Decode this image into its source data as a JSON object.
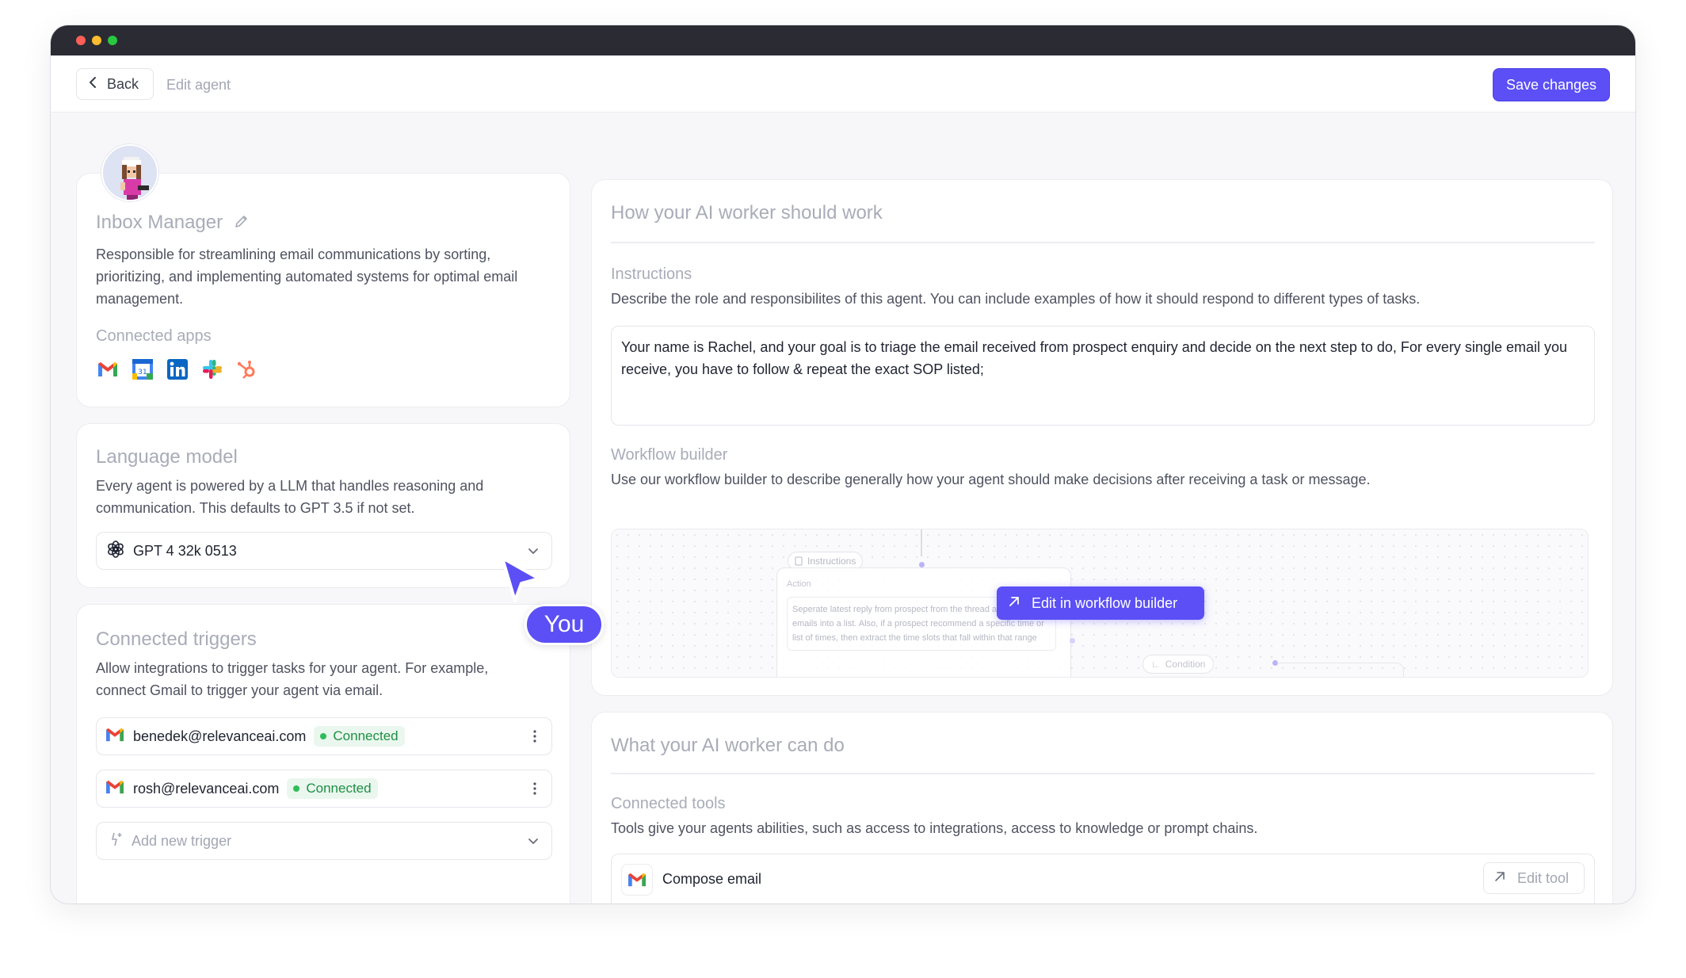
{
  "topbar": {
    "back_label": "Back",
    "breadcrumb": "Edit agent",
    "save_label": "Save changes"
  },
  "agent": {
    "name": "Inbox Manager",
    "description": "Responsible for streamlining email communications by sorting, prioritizing, and implementing automated systems for optimal email management.",
    "connected_apps_label": "Connected apps",
    "apps": [
      "gmail-icon",
      "google-calendar-icon",
      "linkedin-icon",
      "slack-icon",
      "hubspot-icon"
    ]
  },
  "language_model": {
    "title": "Language model",
    "description": "Every agent is powered by a LLM that handles reasoning and communication. This defaults to GPT 3.5 if not set.",
    "selected": "GPT 4 32k 0513"
  },
  "triggers": {
    "title": "Connected triggers",
    "description": "Allow integrations to trigger tasks for your agent. For example, connect Gmail to trigger your agent via email.",
    "items": [
      {
        "email": "benedek@relevanceai.com",
        "status": "Connected"
      },
      {
        "email": "rosh@relevanceai.com",
        "status": "Connected"
      }
    ],
    "add_placeholder": "Add new trigger"
  },
  "how_work": {
    "title": "How your AI worker should work",
    "instructions_label": "Instructions",
    "instructions_desc": "Describe the role and responsibilites of this agent. You can include examples of how it should respond to different types of tasks.",
    "instructions_value": "Your name is Rachel, and your goal is to triage the email received from prospect enquiry and decide on the next step to do, For every single email you receive, you have to follow & repeat the exact SOP listed;",
    "workflow_label": "Workflow builder",
    "workflow_desc": "Use our workflow builder to describe generally how your agent should make decisions after receiving a task or message.",
    "workflow_button": "Edit in workflow builder",
    "preview": {
      "instructions_node": "Instructions",
      "action_label": "Action",
      "action_text": "Seperate latest reply from prospect from the thread and put the emails into a list. Also, if a prospect recommend a specific time or list of times, then extract the time slots that fall within that range",
      "condition_node": "Condition"
    }
  },
  "can_do": {
    "title": "What your AI worker can do",
    "tools_label": "Connected tools",
    "tools_desc": "Tools give your agents abilities, such as access to integrations, access to knowledge or prompt chains.",
    "tool_name": "Compose email",
    "edit_tool_label": "Edit tool"
  },
  "cursor_label": "You",
  "colors": {
    "accent": "#5b4ff5",
    "connected": "#1f8f45",
    "titlebar": "#2a2b33"
  }
}
